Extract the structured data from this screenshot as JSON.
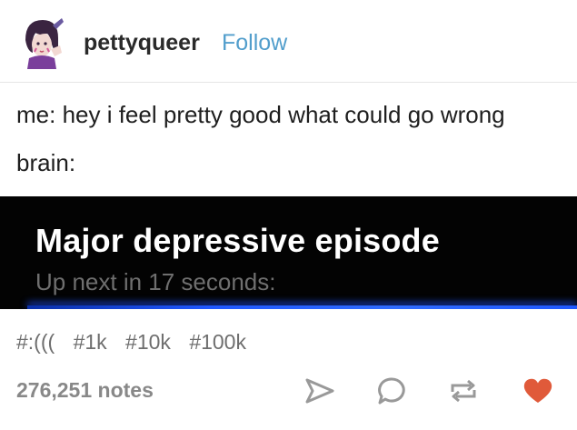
{
  "post": {
    "username": "pettyqueer",
    "follow_label": "Follow",
    "body_lines": [
      "me: hey i feel pretty good what could go wrong",
      "brain:"
    ],
    "video": {
      "title": "Major depressive episode",
      "subtitle": "Up next in 17 seconds:"
    },
    "tags": [
      "#:(((",
      "#1k",
      "#10k",
      "#100k"
    ],
    "notes": "276,251 notes"
  },
  "actions": {
    "share_icon": "paper-plane-icon",
    "reply_icon": "speech-bubble-icon",
    "reblog_icon": "reblog-icon",
    "like_icon": "heart-icon"
  },
  "colors": {
    "follow": "#529ecc",
    "heart": "#e05a3a",
    "icons": "#999999",
    "video_bg": "#030303",
    "video_glow": "#1f57ff"
  }
}
